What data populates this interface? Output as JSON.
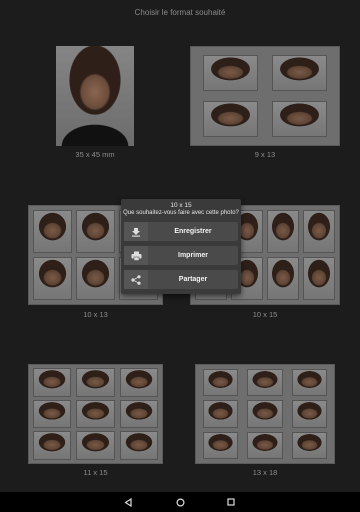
{
  "header": {
    "title": "Choisir le format souhaité"
  },
  "formats": [
    {
      "label": "35 x 45 mm"
    },
    {
      "label": "9 x 13"
    },
    {
      "label": "10 x 13"
    },
    {
      "label": "10 x 15"
    },
    {
      "label": "11 x 15"
    },
    {
      "label": "13 x 18"
    }
  ],
  "dialog": {
    "title": "10 x 15",
    "question": "Que souhaitez-vous faire avec cette photo?",
    "buttons": [
      {
        "label": "Enregistrer",
        "icon": "download-icon"
      },
      {
        "label": "Imprimer",
        "icon": "printer-icon"
      },
      {
        "label": "Partager",
        "icon": "share-icon"
      }
    ]
  },
  "navbar": {
    "buttons": [
      "back-icon",
      "home-icon",
      "recents-icon"
    ]
  }
}
